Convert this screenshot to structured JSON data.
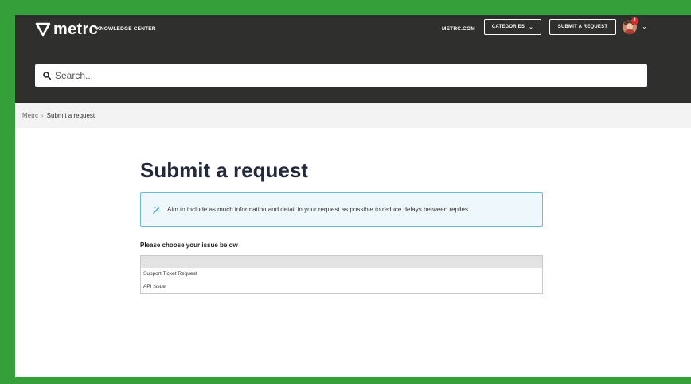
{
  "header": {
    "brand": "metrc",
    "section_label": "KNOWLEDGE CENTER",
    "nav_link": "METRC.COM",
    "categories_label": "CATEGORIES",
    "submit_label": "SUBMIT A REQUEST",
    "notification_count": "1"
  },
  "search": {
    "placeholder": "Search..."
  },
  "breadcrumb": {
    "root": "Metrc",
    "separator": "›",
    "current": "Submit a request"
  },
  "main": {
    "title": "Submit a request",
    "notice": "Aim to include as much information and detail in your request as possible to reduce delays between replies",
    "issue_label": "Please choose your issue below",
    "dropdown": {
      "selected": "-",
      "options": [
        "Support Ticket Request",
        "API Issue"
      ]
    }
  },
  "colors": {
    "frame": "#35a03a",
    "header_bg": "#2f302d",
    "notice_border": "#66bcd6",
    "title": "#22293a"
  }
}
